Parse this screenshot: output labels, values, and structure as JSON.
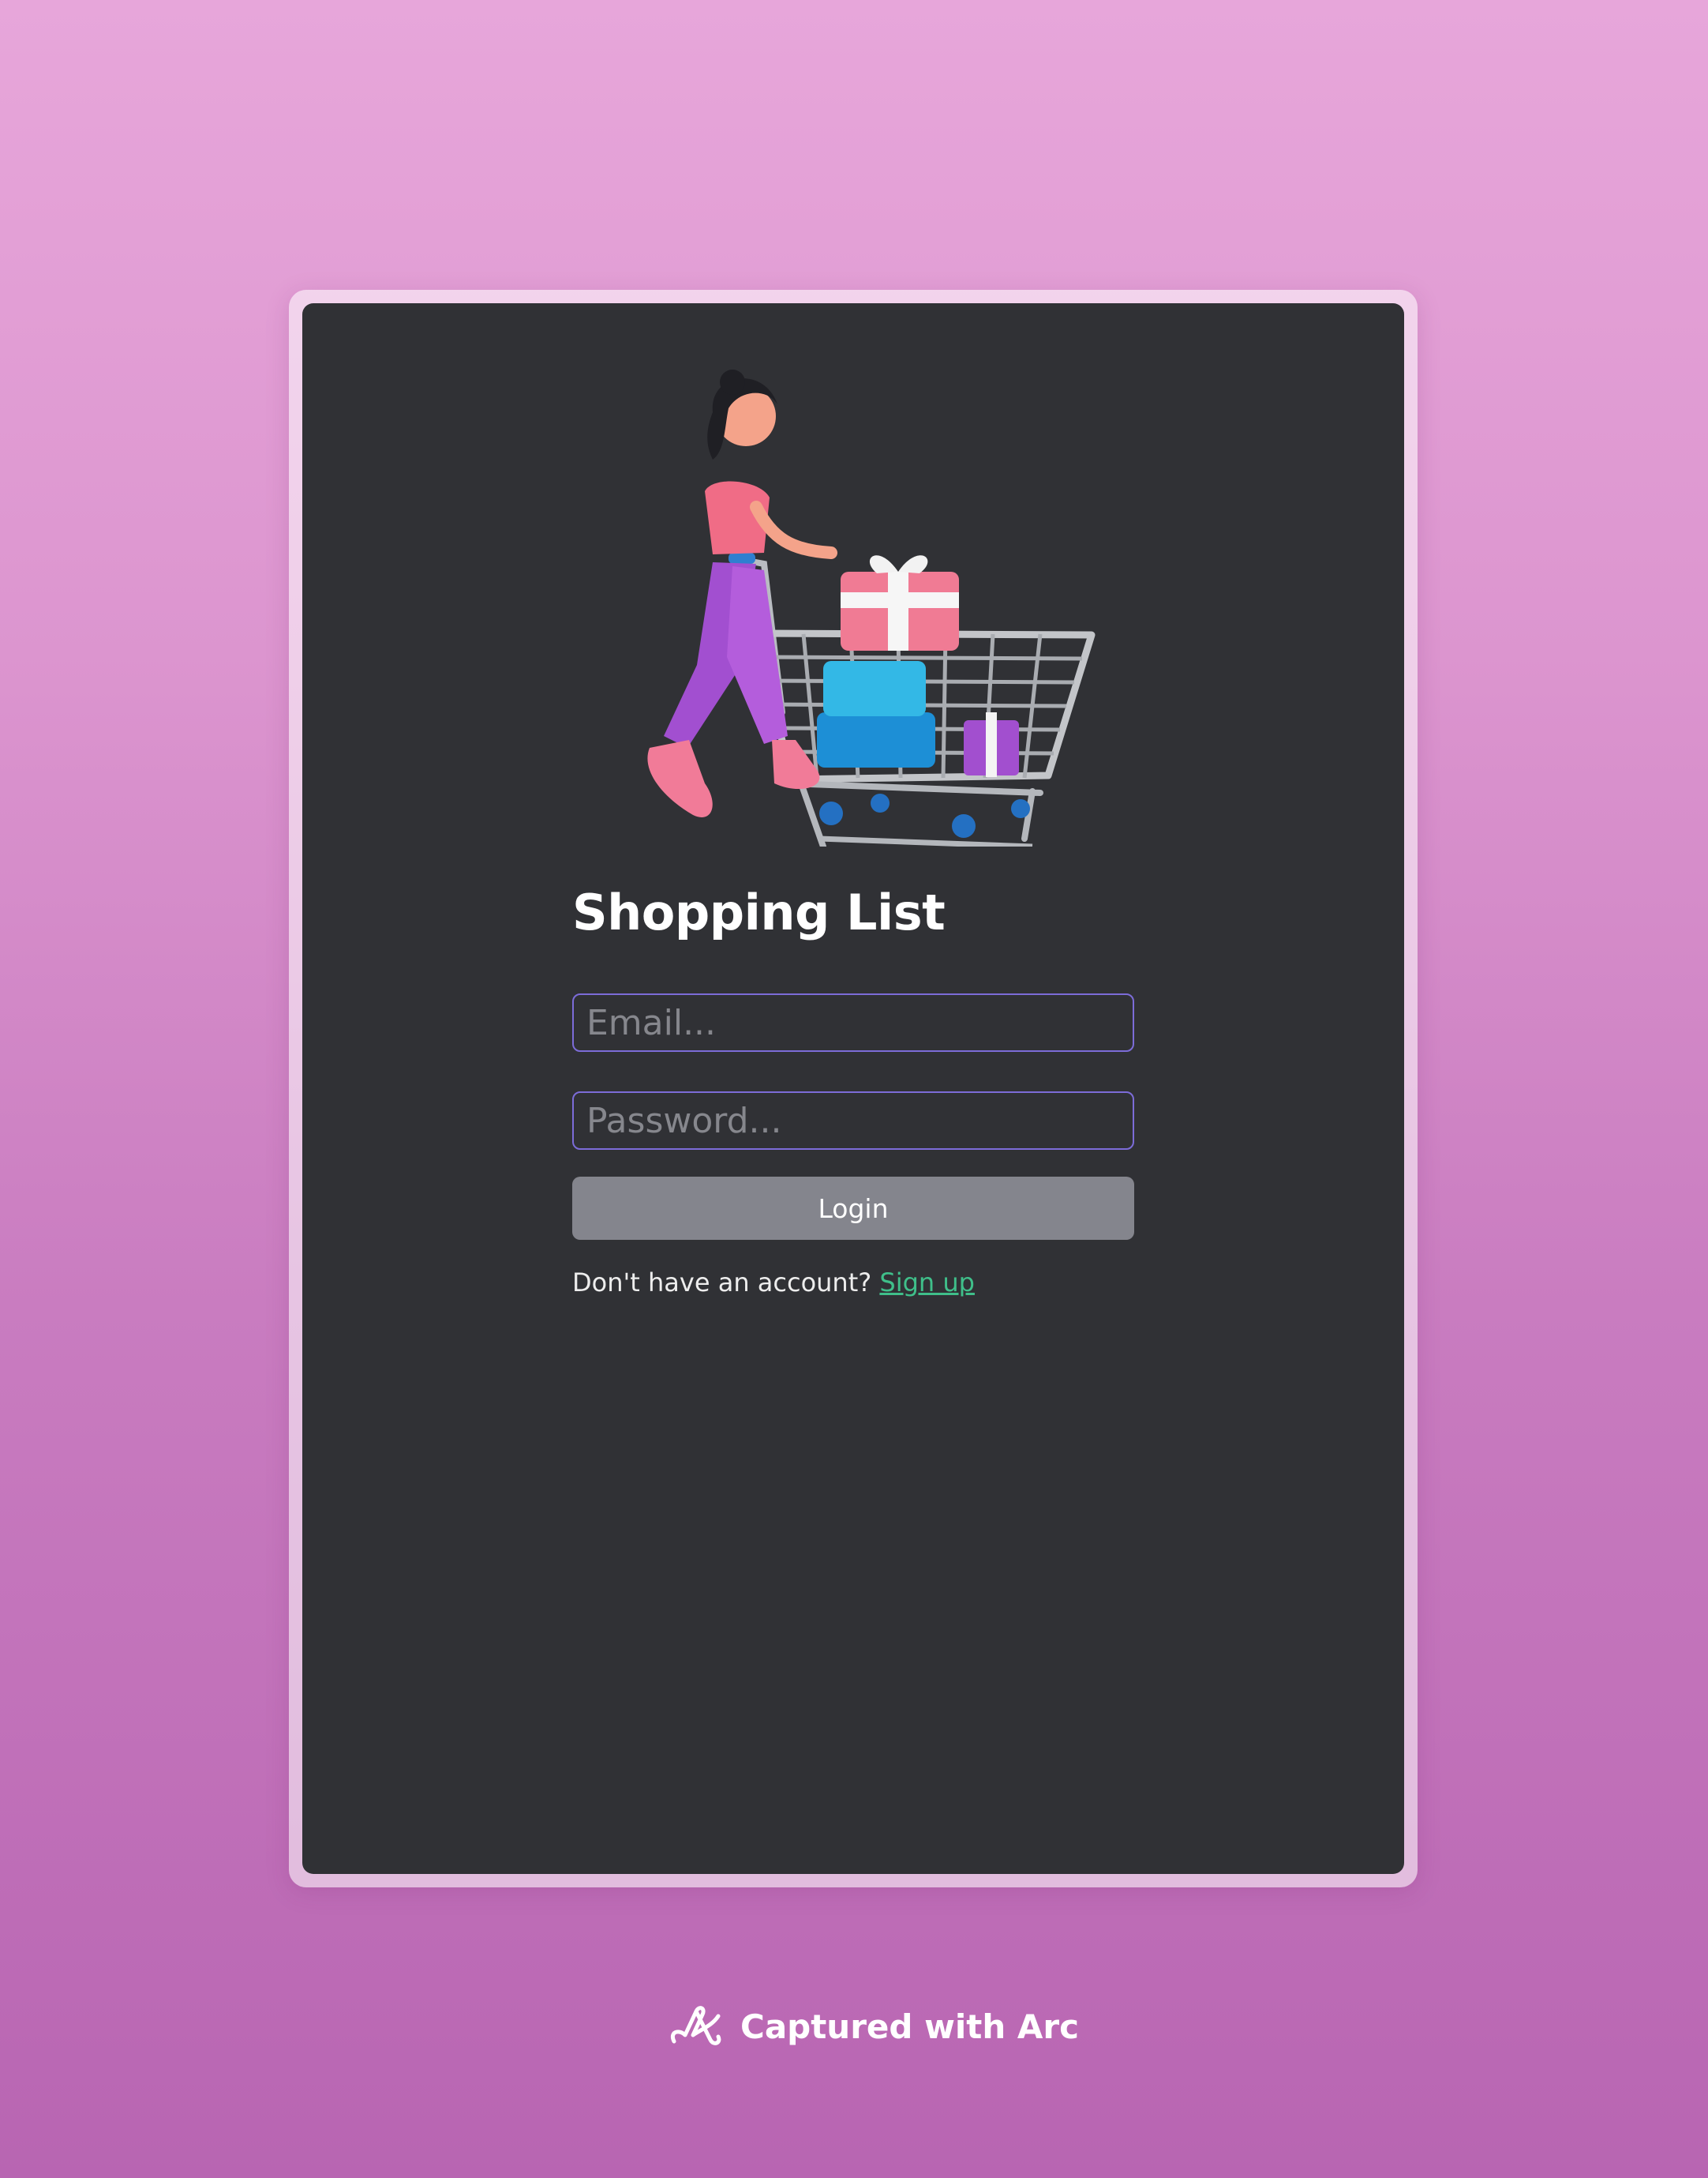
{
  "app": {
    "title": "Shopping List",
    "hero_image": "woman-pushing-shopping-cart-with-gifts"
  },
  "login_form": {
    "email_placeholder": "Email...",
    "email_value": "",
    "password_placeholder": "Password...",
    "password_value": "",
    "login_label": "Login",
    "signup_prompt": "Don't have an account?",
    "signup_link": "Sign up"
  },
  "capture_badge": {
    "icon": "arc-logo-icon",
    "text": "Captured with Arc"
  },
  "colors": {
    "window_bg": "#303135",
    "input_border": "#7c6cd8",
    "button_bg": "#84858d",
    "link": "#3fbf8a",
    "page_gradient_top": "#e7a6da",
    "page_gradient_bottom": "#b865b2"
  }
}
